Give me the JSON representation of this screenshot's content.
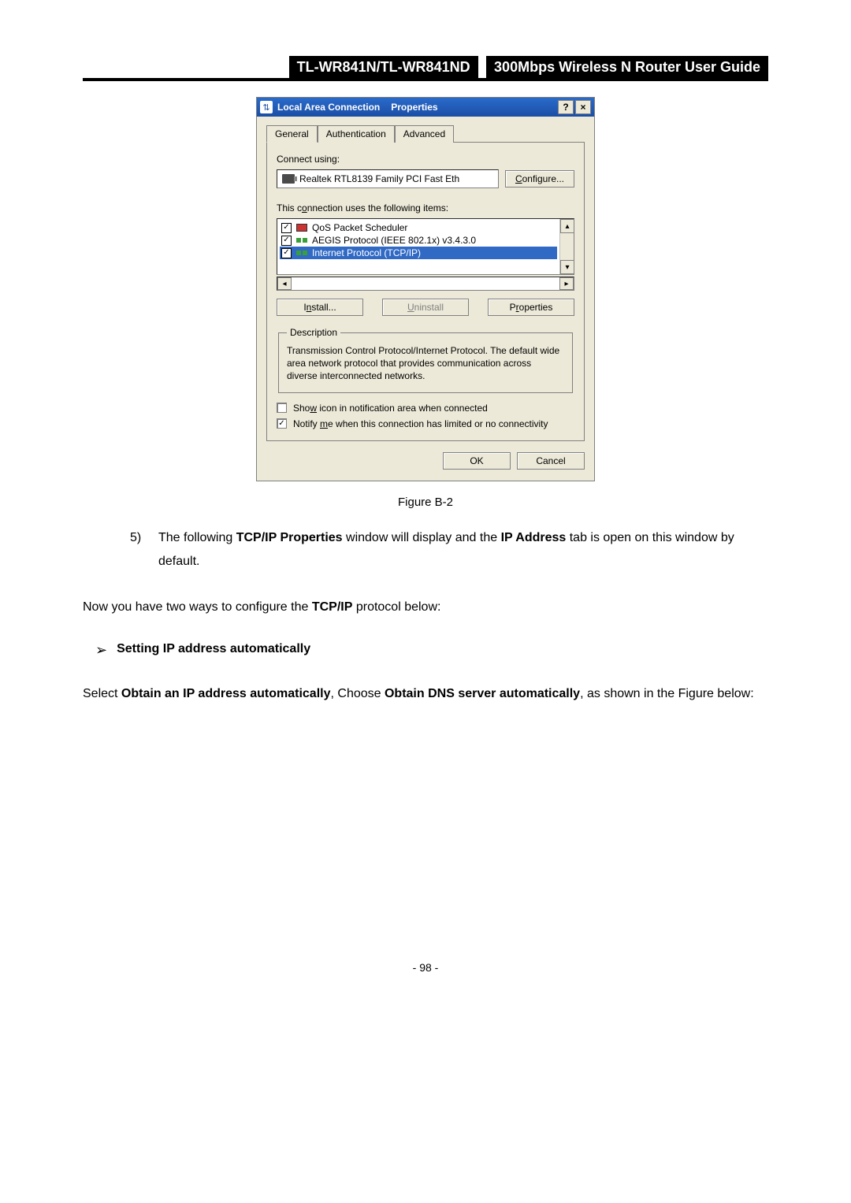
{
  "header": {
    "model": "TL-WR841N/TL-WR841ND",
    "title": "300Mbps Wireless N Router User Guide"
  },
  "dialog": {
    "title1": "Local Area Connection",
    "title2": "Properties",
    "help": "?",
    "close": "×",
    "tabs": {
      "general": "General",
      "auth": "Authentication",
      "adv": "Advanced"
    },
    "connect_using_label": "Connect using:",
    "adapter": "Realtek RTL8139 Family PCI Fast Eth",
    "configure": "Configure...",
    "configure_u": "C",
    "items_label_pre": "This c",
    "items_label_u": "o",
    "items_label_post": "nnection uses the following items:",
    "items": {
      "qos": "QoS Packet Scheduler",
      "aegis": "AEGIS Protocol (IEEE 802.1x) v3.4.3.0",
      "tcpip": "Internet Protocol (TCP/IP)"
    },
    "install": "Install...",
    "install_u": "n",
    "uninstall": "Uninstall",
    "uninstall_u": "U",
    "properties": "Properties",
    "properties_u": "r",
    "desc_legend": "Description",
    "desc_text": "Transmission Control Protocol/Internet Protocol. The default wide area network protocol that provides communication across diverse interconnected networks.",
    "show_icon_pre": "Sho",
    "show_icon_u": "w",
    "show_icon_post": " icon in notification area when connected",
    "notify_pre": "Notify ",
    "notify_u": "m",
    "notify_post": "e when this connection has limited or no connectivity",
    "ok": "OK",
    "cancel": "Cancel"
  },
  "figure_label": "Figure B-2",
  "step": {
    "num": "5)",
    "pre": "The following ",
    "b1": "TCP/IP Properties",
    "mid": " window will display and the ",
    "b2": "IP Address",
    "post": " tab is open on this window by default."
  },
  "para1": {
    "pre": "Now you have two ways to configure the ",
    "b": "TCP/IP",
    "post": " protocol below:"
  },
  "bullet": {
    "mark": "➢",
    "text": "Setting IP address automatically"
  },
  "para2": {
    "pre": "Select ",
    "b1": "Obtain an IP address automatically",
    "mid": ", Choose ",
    "b2": "Obtain DNS server automatically",
    "post": ", as shown in the Figure below:"
  },
  "pagenum": "- 98 -"
}
